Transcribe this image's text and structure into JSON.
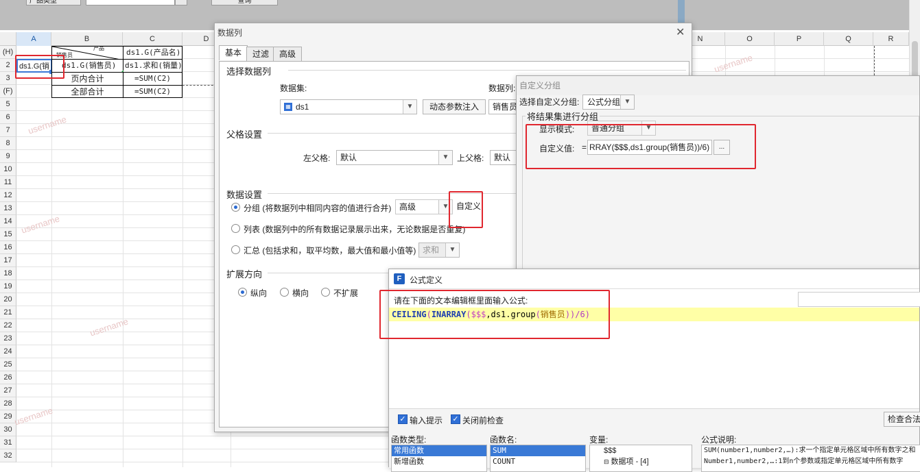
{
  "spreadsheet": {
    "toolbar": {
      "product_type_label": "产品类型",
      "query_button": "查询"
    },
    "columns": [
      "A",
      "B",
      "C",
      "D",
      "N",
      "O",
      "P",
      "Q",
      "R"
    ],
    "rows": [
      "(H)",
      "2",
      "3",
      "(F)",
      "5",
      "6",
      "7",
      "8",
      "9",
      "10",
      "11",
      "12",
      "13",
      "14",
      "15",
      "16",
      "17",
      "18",
      "19",
      "20",
      "21",
      "22",
      "23",
      "24",
      "25",
      "26",
      "27",
      "28",
      "29",
      "30",
      "31",
      "32"
    ],
    "cells": {
      "a2": "ds1.G(销",
      "b1_top": "产品",
      "b1_bottom": "销售员",
      "c1": "ds1.G(产品名)",
      "b2": "ds1.G(销售员)",
      "c2": "ds1.求和(销量)",
      "b3": "页内合计",
      "c3": "=SUM(C2)",
      "b4": "全部合计",
      "c4": "=SUM(C2)"
    },
    "watermark": "username"
  },
  "data_column_dialog": {
    "title": "数据列",
    "tabs": [
      "基本",
      "过滤",
      "高级"
    ],
    "select_section": "选择数据列",
    "dataset_label": "数据集:",
    "dataset_value": "ds1",
    "dynamic_param_button": "动态参数注入",
    "column_label": "数据列:",
    "column_value": "销售员",
    "parent_section": "父格设置",
    "left_parent_label": "左父格:",
    "left_parent_value": "默认",
    "top_parent_label": "上父格:",
    "top_parent_value": "默认",
    "data_section": "数据设置",
    "group_option": "分组 (将数据列中相同内容的值进行合并)",
    "group_mode": "高级",
    "custom_button": "自定义",
    "list_option": "列表 (数据列中的所有数据记录展示出来，无论数据是否重复)",
    "summary_option": "汇总 (包括求和，取平均数，最大值和最小值等)",
    "summary_mode": "求和",
    "expand_section": "扩展方向",
    "expand_options": [
      "纵向",
      "横向",
      "不扩展"
    ]
  },
  "custom_group_dialog": {
    "title": "自定义分组",
    "select_label": "选择自定义分组:",
    "select_value": "公式分组",
    "group_section": "将结果集进行分组",
    "display_mode_label": "显示模式:",
    "display_mode_value": "普通分组",
    "custom_value_label": "自定义值:",
    "custom_value_prefix": "=",
    "custom_value": "RRAY($$$,ds1.group(销售员))/6)",
    "ellipsis_button": "..."
  },
  "formula_dialog": {
    "title": "公式定义",
    "prompt": "请在下面的文本编辑框里面输入公式:",
    "formula_parts": [
      "CEILING",
      "(",
      "INARRAY",
      "(",
      "$$$",
      ",ds1.",
      "group",
      "(",
      "销售员",
      "))/6)"
    ],
    "input_hint_label": "输入提示",
    "close_check_label": "关闭前检查",
    "check_button": "检查合法",
    "func_type_header": "函数类型:",
    "func_types": [
      "常用函数",
      "新增函数"
    ],
    "func_name_header": "函数名:",
    "func_names": [
      "SUM",
      "COUNT"
    ],
    "var_header": "变量:",
    "vars": [
      "$$$",
      "数据项 - [4]"
    ],
    "desc_header": "公式说明:",
    "desc_lines": [
      "SUM(number1,number2,…):求一个指定单元格区域中所有数字之和",
      "Number1,number2,…:1到n个参数或指定单元格区域中所有数字"
    ]
  },
  "colors": {
    "highlight_red": "#e0262e",
    "accent_blue": "#2f6fd6",
    "formula_yellow": "#ffffa6"
  }
}
